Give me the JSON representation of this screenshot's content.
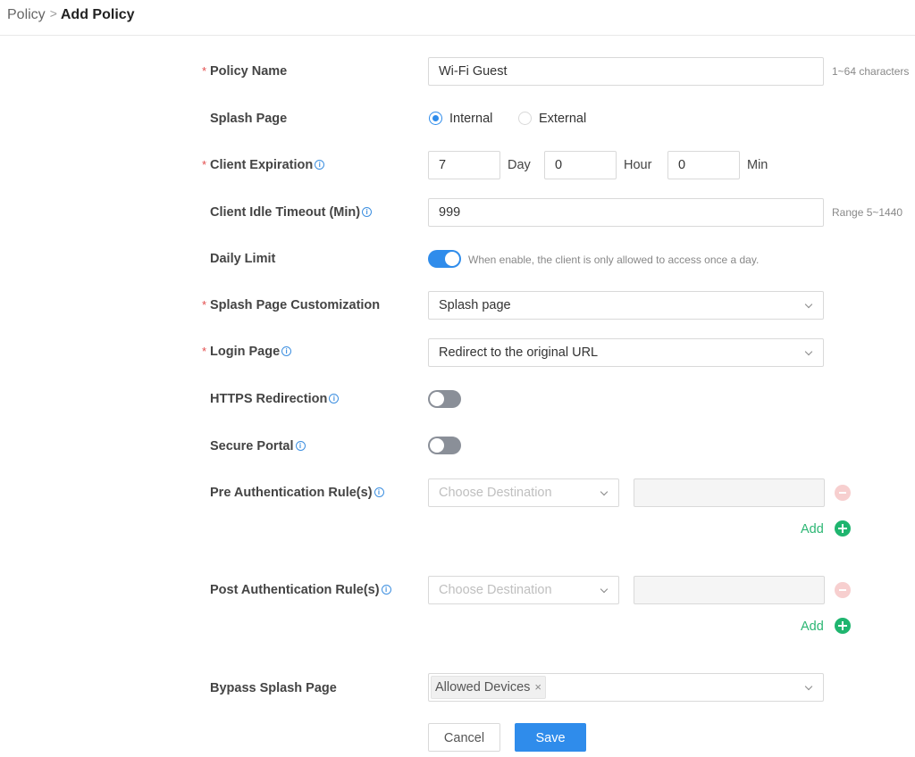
{
  "breadcrumb": {
    "parent": "Policy",
    "separator": ">",
    "current": "Add Policy"
  },
  "required_mark": "*",
  "info_glyph": "i",
  "form": {
    "policy_name": {
      "label": "Policy Name",
      "value": "Wi-Fi Guest",
      "hint": "1~64 characters"
    },
    "splash_page": {
      "label": "Splash Page",
      "options": [
        "Internal",
        "External"
      ],
      "selected": "Internal"
    },
    "client_expiration": {
      "label": "Client Expiration",
      "day_value": "7",
      "day_unit": "Day",
      "hour_value": "0",
      "hour_unit": "Hour",
      "min_value": "0",
      "min_unit": "Min"
    },
    "client_idle_timeout": {
      "label": "Client Idle Timeout (Min)",
      "value": "999",
      "hint": "Range 5~1440"
    },
    "daily_limit": {
      "label": "Daily Limit",
      "enabled": true,
      "hint": "When enable, the client is only allowed to access once a day."
    },
    "splash_page_customization": {
      "label": "Splash Page Customization",
      "value": "Splash page"
    },
    "login_page": {
      "label": "Login Page",
      "value": "Redirect to the original URL"
    },
    "https_redirection": {
      "label": "HTTPS Redirection",
      "enabled": false
    },
    "secure_portal": {
      "label": "Secure Portal",
      "enabled": false
    },
    "pre_auth_rules": {
      "label": "Pre Authentication Rule(s)",
      "destination_placeholder": "Choose Destination",
      "value": "",
      "add_label": "Add"
    },
    "post_auth_rules": {
      "label": "Post Authentication Rule(s)",
      "destination_placeholder": "Choose Destination",
      "value": "",
      "add_label": "Add"
    },
    "bypass_splash_page": {
      "label": "Bypass Splash Page",
      "tags": [
        "Allowed Devices"
      ],
      "tag_close": "×"
    }
  },
  "actions": {
    "cancel": "Cancel",
    "save": "Save"
  },
  "colors": {
    "primary": "#2f8ceb",
    "success": "#1fb56f",
    "required": "#e34d4d",
    "danger_light": "#f7cfcf",
    "toggle_off": "#8a8f98"
  },
  "icons": {
    "info": "info-circle-icon",
    "chevron": "chevron-down-icon",
    "remove": "minus-circle-icon",
    "add": "plus-circle-icon",
    "tag_close": "close-icon"
  }
}
